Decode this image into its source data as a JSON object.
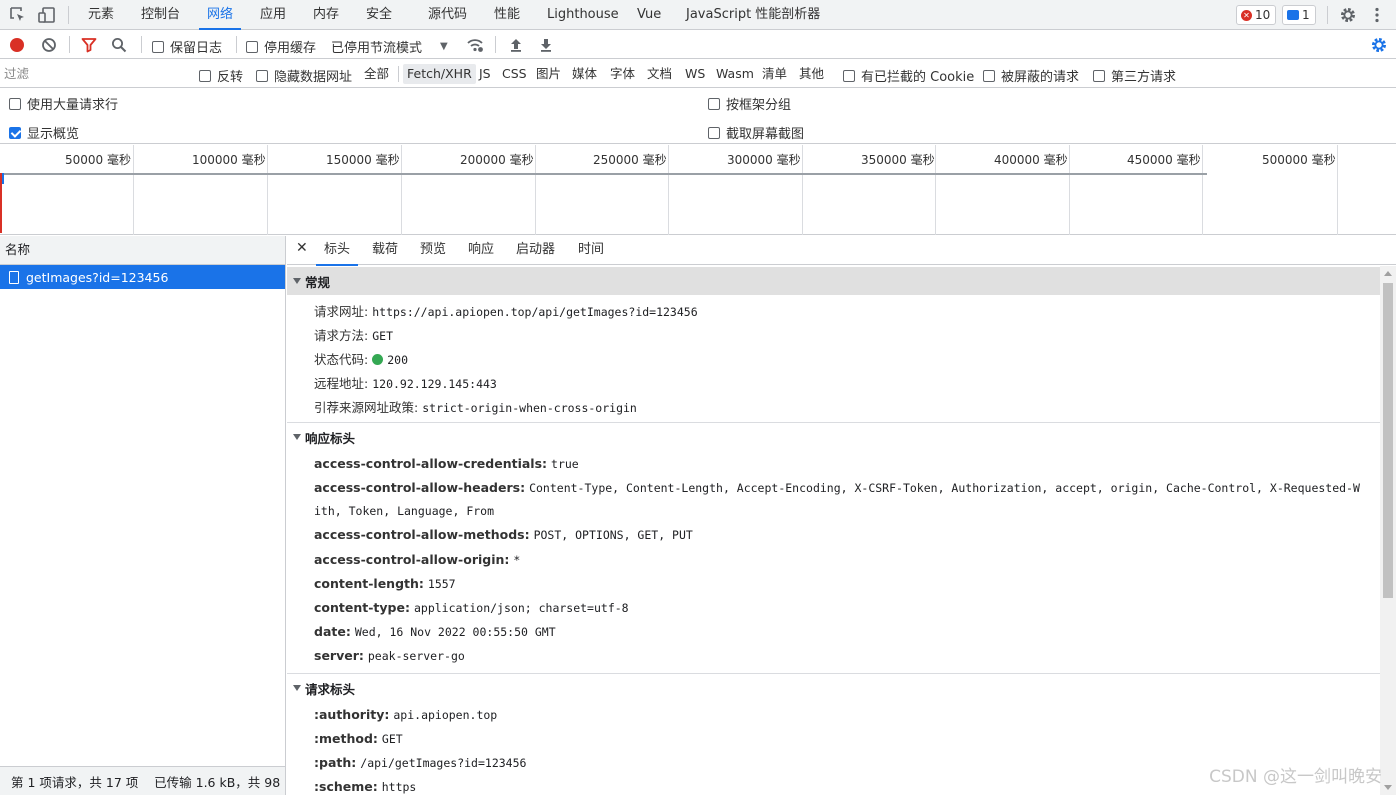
{
  "top_tabs": [
    "元素",
    "控制台",
    "网络",
    "应用",
    "内存",
    "安全",
    "源代码",
    "性能",
    "Lighthouse",
    "Vue",
    "JavaScript 性能剖析器"
  ],
  "active_tab": "网络",
  "badges": {
    "errors": "10",
    "messages": "1"
  },
  "toolbar": {
    "preserve_log": "保留日志",
    "disable_cache": "停用缓存",
    "throttle": "已停用节流模式"
  },
  "filter": {
    "placeholder": "过滤",
    "invert": "反转",
    "hide_data_urls": "隐藏数据网址",
    "types": [
      "全部",
      "Fetch/XHR",
      "JS",
      "CSS",
      "图片",
      "媒体",
      "字体",
      "文档",
      "WS",
      "Wasm",
      "清单",
      "其他"
    ],
    "active_type": "Fetch/XHR",
    "blocked_cookies": "有已拦截的 Cookie",
    "blocked_requests": "被屏蔽的请求",
    "third_party": "第三方请求"
  },
  "options": {
    "large_rows": "使用大量请求行",
    "group_by_frame": "按框架分组",
    "show_overview": "显示概览",
    "capture_screenshots": "截取屏幕截图"
  },
  "overview_ticks": [
    "50000 毫秒",
    "100000 毫秒",
    "150000 毫秒",
    "200000 毫秒",
    "250000 毫秒",
    "300000 毫秒",
    "350000 毫秒",
    "400000 毫秒",
    "450000 毫秒",
    "500000 毫秒"
  ],
  "request_list": {
    "header": "名称",
    "rows": [
      "getImages?id=123456"
    ],
    "status": "第 1 项请求，共 17 项    已传输 1.6 kB，共 98"
  },
  "detail_tabs": [
    "标头",
    "载荷",
    "预览",
    "响应",
    "启动器",
    "时间"
  ],
  "general": {
    "title": "常规",
    "rows": [
      {
        "k": "请求网址:",
        "v": "https://api.apiopen.top/api/getImages?id=123456"
      },
      {
        "k": "请求方法:",
        "v": "GET"
      },
      {
        "k": "状态代码:",
        "v": "200"
      },
      {
        "k": "远程地址:",
        "v": "120.92.129.145:443"
      },
      {
        "k": "引荐来源网址政策:",
        "v": "strict-origin-when-cross-origin"
      }
    ]
  },
  "response_headers": {
    "title": "响应标头",
    "rows": [
      {
        "k": "access-control-allow-credentials:",
        "v": "true"
      },
      {
        "k": "access-control-allow-headers:",
        "v": "Content-Type, Content-Length, Accept-Encoding, X-CSRF-Token, Authorization, accept, origin, Cache-Control, X-Requested-W"
      },
      {
        "k": "",
        "v": "ith, Token, Language, From"
      },
      {
        "k": "access-control-allow-methods:",
        "v": "POST, OPTIONS, GET, PUT"
      },
      {
        "k": "access-control-allow-origin:",
        "v": "*"
      },
      {
        "k": "content-length:",
        "v": "1557"
      },
      {
        "k": "content-type:",
        "v": "application/json; charset=utf-8"
      },
      {
        "k": "date:",
        "v": "Wed, 16 Nov 2022 00:55:50 GMT"
      },
      {
        "k": "server:",
        "v": "peak-server-go"
      }
    ]
  },
  "request_headers": {
    "title": "请求标头",
    "rows": [
      {
        "k": ":authority:",
        "v": "api.apiopen.top"
      },
      {
        "k": ":method:",
        "v": "GET"
      },
      {
        "k": ":path:",
        "v": "/api/getImages?id=123456"
      },
      {
        "k": ":scheme:",
        "v": "https"
      }
    ]
  },
  "watermark": "CSDN @这一剑叫晚安",
  "colors": {
    "accent": "#1a73e8",
    "record": "#d93025",
    "status_ok": "#34a853"
  }
}
